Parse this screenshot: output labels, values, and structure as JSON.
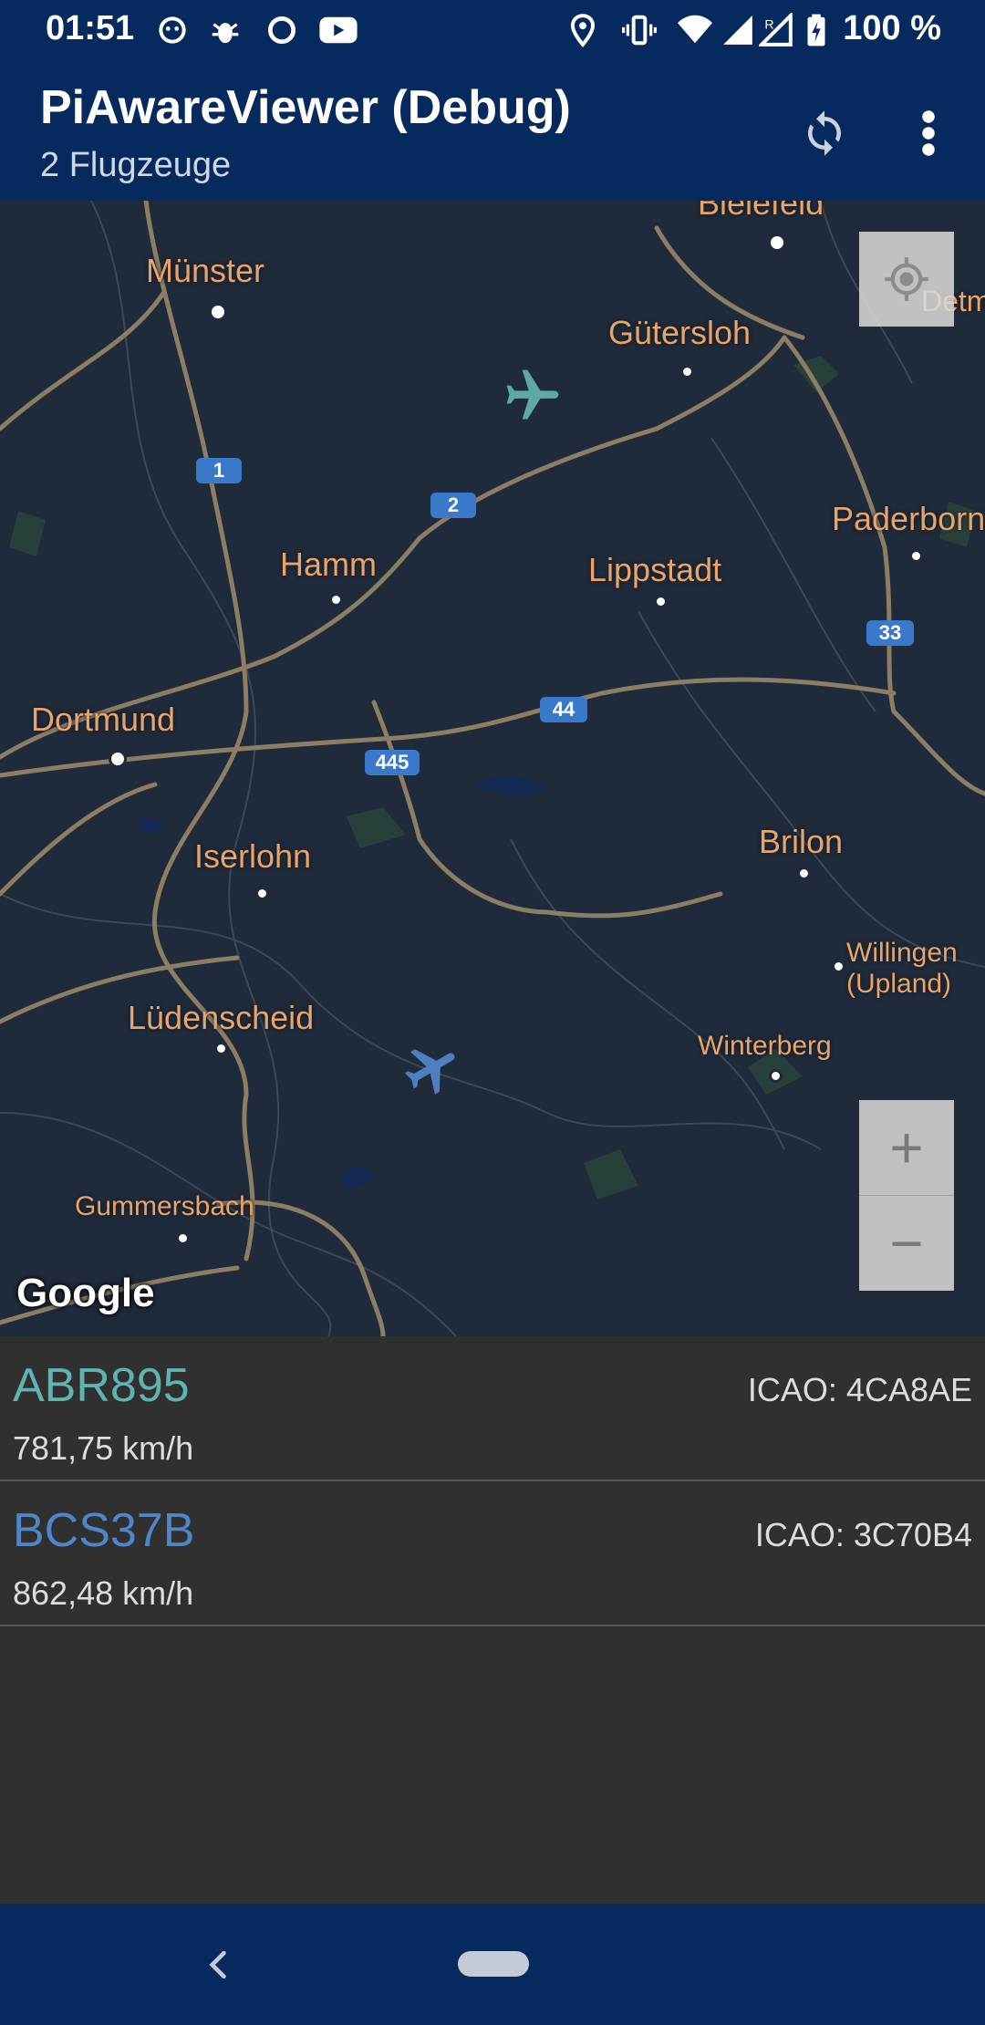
{
  "status_bar": {
    "time": "01:51",
    "battery": "100 %"
  },
  "app_bar": {
    "title": "PiAwareViewer (Debug)",
    "subtitle": "2 Flugzeuge",
    "refresh_icon": "refresh-icon",
    "overflow_icon": "more-vert-icon"
  },
  "map": {
    "cities": {
      "bielefeld": "Bielefeld",
      "muenster": "Münster",
      "guetersloh": "Gütersloh",
      "detmold": "Detm",
      "paderborn": "Paderborn",
      "hamm": "Hamm",
      "lippstadt": "Lippstadt",
      "dortmund": "Dortmund",
      "iserlohn": "Iserlohn",
      "brilon": "Brilon",
      "willingen_1": "Willingen",
      "willingen_2": "(Upland)",
      "luedenscheid": "Lüdenscheid",
      "winterberg": "Winterberg",
      "gummersbach": "Gummersbach"
    },
    "highways": {
      "a1": "1",
      "a2": "2",
      "a33": "33",
      "a44": "44",
      "a445": "445"
    },
    "zoom_in_label": "+",
    "zoom_out_label": "−",
    "google_logo": "Google",
    "colors": {
      "plane_1": "#5fa8a8",
      "plane_2": "#4f7fc0",
      "background": "#1f2a3a",
      "label": "#e8a56b"
    }
  },
  "aircraft": [
    {
      "callsign": "ABR895",
      "speed": "781,75 km/h",
      "icao": "ICAO: 4CA8AE",
      "color": "#5fb3b0"
    },
    {
      "callsign": "BCS37B",
      "speed": "862,48 km/h",
      "icao": "ICAO: 3C70B4",
      "color": "#4f86c6"
    }
  ]
}
